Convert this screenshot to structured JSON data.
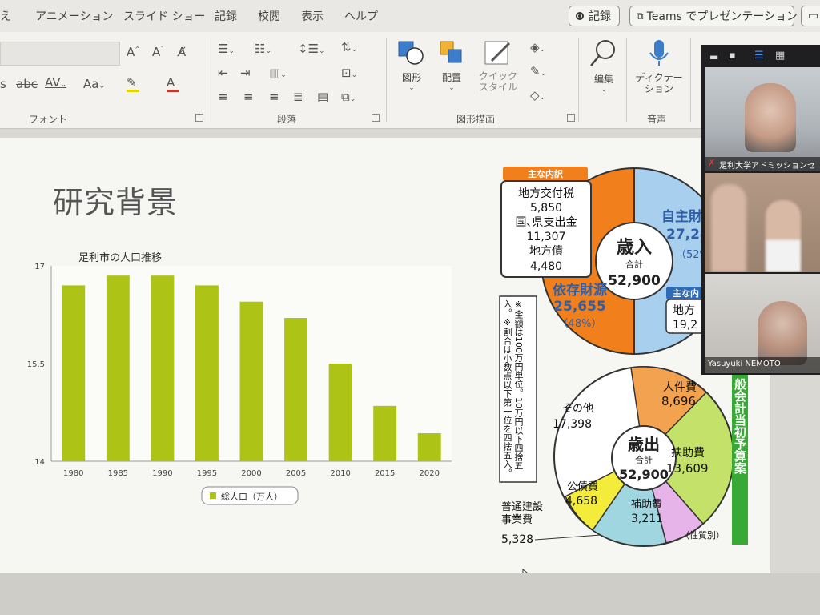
{
  "menu": {
    "items": [
      "え",
      "アニメーション",
      "スライド ショー",
      "記録",
      "校閲",
      "表示",
      "ヘルプ"
    ],
    "record_label": "記録",
    "teams_label": "Teams でプレゼンテーション"
  },
  "ribbon": {
    "font_group": "フォント",
    "paragraph_group": "段落",
    "drawing_group": "図形描画",
    "voice_group": "音声",
    "shapes_label": "図形",
    "arrange_label": "配置",
    "quick_style_label": "クイック\nスタイル",
    "edit_label": "編集",
    "dictate_label": "ディクテー\nション",
    "abc_label": "abc",
    "av_label": "AV",
    "aa_label": "Aa"
  },
  "slide": {
    "title": "研究背景"
  },
  "chart_data": {
    "type": "bar",
    "title": "足利市の人口推移",
    "categories": [
      "1980",
      "1985",
      "1990",
      "1995",
      "2000",
      "2005",
      "2010",
      "2015",
      "2020"
    ],
    "series": [
      {
        "name": "総人口（万人）",
        "values": [
          16.7,
          16.85,
          16.85,
          16.7,
          16.45,
          16.2,
          15.5,
          14.85,
          14.43
        ]
      }
    ],
    "ylim": [
      14,
      17
    ],
    "yticks": [
      "14",
      "15.5",
      "17"
    ],
    "legend": "bottom",
    "grid": false,
    "bar_color": "#adc316"
  },
  "budget": {
    "revenue": {
      "breakdown_label": "主な内訳",
      "items": [
        "地方交付税",
        "5,850",
        "国､県支出金",
        "11,307",
        "地方債",
        "4,480"
      ],
      "center_title": "歳入",
      "center_sub": "合計",
      "center_value": "52,900",
      "dependent_label": "依存財源",
      "dependent_value": "25,655",
      "dependent_pct": "（48%）",
      "own_label": "自主財",
      "own_value": "27,24",
      "own_pct": "（52%",
      "blue_label": "主な内",
      "blue_item": "地方",
      "blue_value": "19,2"
    },
    "note": "※金額は100万円単位。10万円以下四捨五入。※割合は小数点以下第一位を四捨五入。",
    "expenditure": {
      "center_title": "歳出",
      "center_sub": "合計",
      "center_value": "52,900",
      "labels": [
        {
          "name": "人件費",
          "value": "8,696"
        },
        {
          "name": "扶助費",
          "value": "13,609"
        },
        {
          "name": "補助費",
          "value": "3,211"
        },
        {
          "name": "公債費",
          "value": "4,658"
        },
        {
          "name": "その他",
          "value": "17,398"
        }
      ],
      "construction_label": "普通建設\n事業費",
      "construction_value": "5,328",
      "nature_label": "（性質別）"
    },
    "side_title": "般会計当初予算案"
  },
  "zoom": {
    "tile1_name": "足利大学アドミッションセ",
    "tile3_name": "Yasuyuki NEMOTO"
  },
  "colors": {
    "orange": "#f07f1c",
    "blue": "#a9cfee",
    "green": "#39a935"
  }
}
